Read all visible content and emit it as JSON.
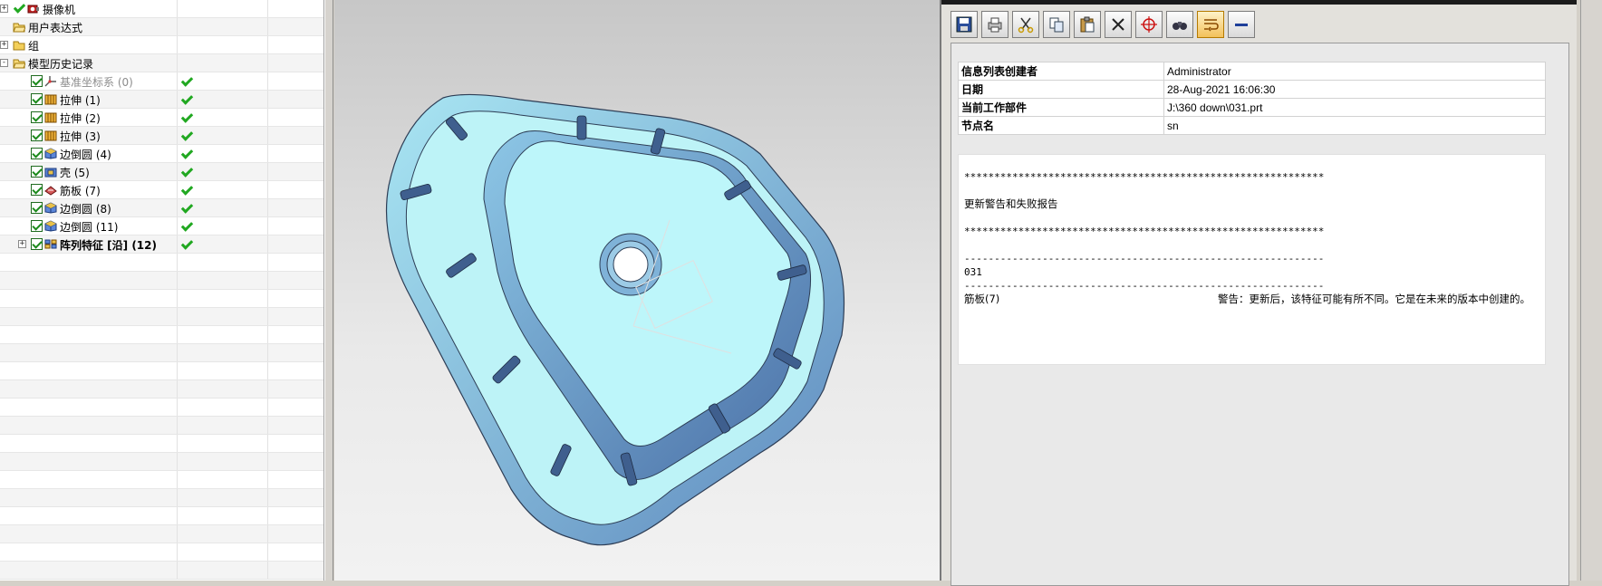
{
  "navigator": {
    "rows": [
      {
        "name": "摄像机",
        "level": 1,
        "icon": "camera-icon",
        "expander": "+",
        "check": false,
        "status": "ok",
        "dim": false,
        "bold": false
      },
      {
        "name": "用户表达式",
        "level": 1,
        "icon": "folder-open-icon",
        "expander": "",
        "check": false,
        "status": "",
        "dim": false,
        "bold": false
      },
      {
        "name": "组",
        "level": 1,
        "icon": "folder-icon",
        "expander": "+",
        "check": false,
        "status": "",
        "dim": false,
        "bold": false
      },
      {
        "name": "模型历史记录",
        "level": 1,
        "icon": "folder-open-icon",
        "expander": "-",
        "check": false,
        "status": "",
        "dim": false,
        "bold": false
      },
      {
        "name": "基准坐标系 (0)",
        "level": 2,
        "icon": "datum-csys-icon",
        "expander": "",
        "check": true,
        "status": "ok",
        "dim": true,
        "bold": false
      },
      {
        "name": "拉伸 (1)",
        "level": 2,
        "icon": "extrude-icon",
        "expander": "",
        "check": true,
        "status": "ok",
        "dim": false,
        "bold": false
      },
      {
        "name": "拉伸 (2)",
        "level": 2,
        "icon": "extrude-icon",
        "expander": "",
        "check": true,
        "status": "ok",
        "dim": false,
        "bold": false
      },
      {
        "name": "拉伸 (3)",
        "level": 2,
        "icon": "extrude-icon",
        "expander": "",
        "check": true,
        "status": "ok",
        "dim": false,
        "bold": false
      },
      {
        "name": "边倒圆 (4)",
        "level": 2,
        "icon": "edge-blend-icon",
        "expander": "",
        "check": true,
        "status": "ok",
        "dim": false,
        "bold": false
      },
      {
        "name": "壳 (5)",
        "level": 2,
        "icon": "shell-icon",
        "expander": "",
        "check": true,
        "status": "ok",
        "dim": false,
        "bold": false
      },
      {
        "name": "筋板 (7)",
        "level": 2,
        "icon": "rib-icon",
        "expander": "",
        "check": true,
        "status": "ok",
        "dim": false,
        "bold": false
      },
      {
        "name": "边倒圆 (8)",
        "level": 2,
        "icon": "edge-blend-icon",
        "expander": "",
        "check": true,
        "status": "ok",
        "dim": false,
        "bold": false
      },
      {
        "name": "边倒圆 (11)",
        "level": 2,
        "icon": "edge-blend-icon",
        "expander": "",
        "check": true,
        "status": "ok",
        "dim": false,
        "bold": false
      },
      {
        "name": "阵列特征 [沿] (12)",
        "level": 2,
        "icon": "pattern-feature-icon",
        "expander": "+",
        "check": true,
        "status": "ok",
        "dim": false,
        "bold": true
      }
    ],
    "empty_rows": 18
  },
  "toolbar": {
    "buttons": [
      {
        "icon": "save-icon"
      },
      {
        "icon": "print-icon"
      },
      {
        "icon": "cut-icon"
      },
      {
        "icon": "copy-icon"
      },
      {
        "icon": "paste-icon"
      },
      {
        "icon": "delete-icon"
      },
      {
        "icon": "find-point-icon"
      },
      {
        "icon": "binoculars-icon"
      },
      {
        "icon": "word-wrap-icon",
        "active": true
      },
      {
        "icon": "minimize-icon"
      }
    ]
  },
  "info": {
    "meta": [
      {
        "key": "信息列表创建者",
        "value": "Administrator"
      },
      {
        "key": "日期",
        "value": "28-Aug-2021 16:06:30"
      },
      {
        "key": "当前工作部件",
        "value": "J:\\360 down\\031.prt"
      },
      {
        "key": "节点名",
        "value": "sn"
      }
    ],
    "report": {
      "stars": "************************************************************",
      "title": "更新警告和失败报告",
      "dashes": "------------------------------------------------------------",
      "part": "031",
      "feature": "筋板(7)",
      "warning": "警告：更新后，该特征可能有所不同。它是在未来的版本中创建的。"
    }
  },
  "colors": {
    "model_face": "#b9f3f6",
    "model_shadow": "#5c84b8",
    "status_green": "#21a821"
  }
}
